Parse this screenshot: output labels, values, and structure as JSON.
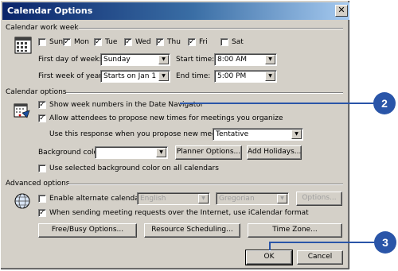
{
  "window": {
    "title": "Calendar Options",
    "close_glyph": "✕"
  },
  "work_week": {
    "header": "Calendar work week",
    "days": [
      {
        "label": "Sun",
        "checked": false
      },
      {
        "label": "Mon",
        "checked": true
      },
      {
        "label": "Tue",
        "checked": true
      },
      {
        "label": "Wed",
        "checked": true
      },
      {
        "label": "Thu",
        "checked": true
      },
      {
        "label": "Fri",
        "checked": true
      },
      {
        "label": "Sat",
        "checked": false
      }
    ],
    "first_day_label": "First day of week:",
    "first_day_value": "Sunday",
    "start_time_label": "Start time:",
    "start_time_value": "8:00 AM",
    "first_week_label": "First week of year:",
    "first_week_value": "Starts on Jan 1",
    "end_time_label": "End time:",
    "end_time_value": "5:00 PM"
  },
  "calendar_options": {
    "header": "Calendar options",
    "show_week_numbers": "Show week numbers in the Date Navigator",
    "allow_attendees": "Allow attendees to propose new times for meetings you organize",
    "response_label": "Use this response when you propose new meeting times:",
    "response_value": "Tentative",
    "background_color_label": "Background color:",
    "background_color_value": "",
    "planner_button": "Planner Options...",
    "holidays_button": "Add Holidays...",
    "use_selected_bg": "Use selected background color on all calendars"
  },
  "advanced": {
    "header": "Advanced options",
    "enable_alt_calendar": "Enable alternate calendar:",
    "alt_language": "English",
    "alt_calendar": "Gregorian",
    "alt_options_button": "Options...",
    "icalendar": "When sending meeting requests over the Internet, use iCalendar format",
    "freebusy_button": "Free/Busy Options...",
    "resource_button": "Resource Scheduling...",
    "timezone_button": "Time Zone..."
  },
  "footer": {
    "ok_button": "OK",
    "cancel_button": "Cancel"
  },
  "callouts": {
    "step_2": "2",
    "step_3": "3"
  },
  "check_glyph": "✓",
  "dropdown_glyph": "▼",
  "colors": {
    "title_start": "#0a246a",
    "title_end": "#a6caf0",
    "callout": "#2a55a8",
    "dialog_bg": "#d4d0c8"
  }
}
